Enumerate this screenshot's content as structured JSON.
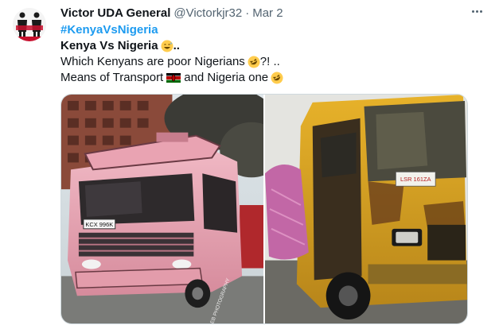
{
  "tweet": {
    "author_name": "Victor UDA General",
    "handle": "@Victorkjr32",
    "separator": "·",
    "date": "Mar 2",
    "hashtag": "#KenyaVsNigeria",
    "line1": "Kenya Vs Nigeria",
    "line1_suffix": "..",
    "line2": "Which Kenyans are poor Nigerians",
    "line2_suffix": "?! ..",
    "line3_a": "Means of  Transport",
    "line3_b": "and Nigeria one"
  },
  "icons": {
    "more": "more-horizontal-icon",
    "emoji_sweat": "grinning-sweat-emoji",
    "emoji_rofl": "rolling-laughing-emoji",
    "flag": "kenya-flag-icon"
  },
  "media": {
    "left_plate": "KCX 996K",
    "left_watermark": "CALEB PHOTOGRAPHY",
    "right_sign": "LSR 161ZA"
  },
  "colors": {
    "hashtag": "#1d9bf0",
    "secondary": "#536471",
    "primary": "#0f1419",
    "pink_bus": "#e8a7b4",
    "yellow_bus": "#d9a21c"
  }
}
